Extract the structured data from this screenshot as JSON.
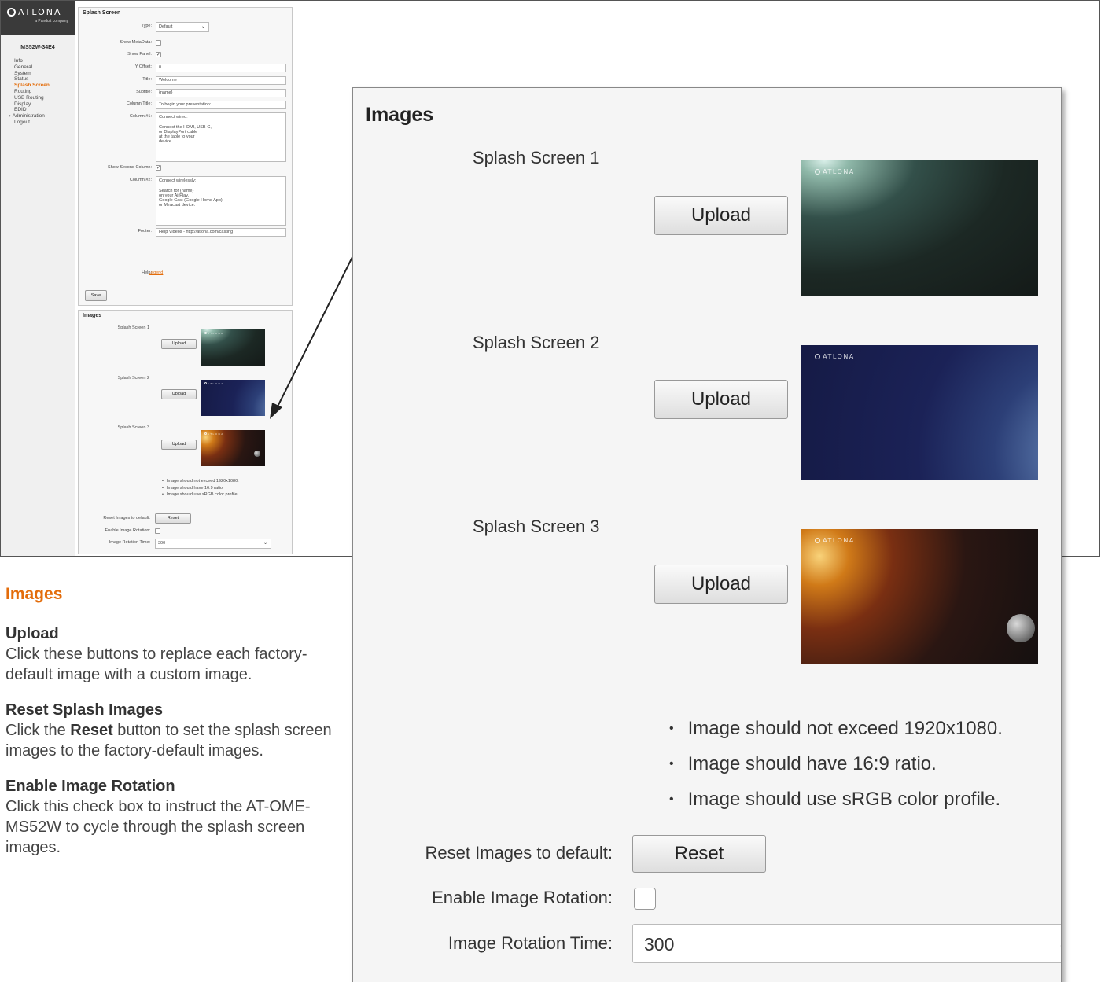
{
  "sidebar": {
    "logo": "ATLONA",
    "logo_sub": "a Panduit company",
    "device": "MS52W-34E4",
    "nav": [
      {
        "label": "Info",
        "active": false
      },
      {
        "label": "General",
        "active": false
      },
      {
        "label": "System",
        "active": false
      },
      {
        "label": "Status",
        "active": false
      },
      {
        "label": "Splash Screen",
        "active": true
      },
      {
        "label": "Routing",
        "active": false
      },
      {
        "label": "USB Routing",
        "active": false
      },
      {
        "label": "Display",
        "active": false
      },
      {
        "label": "EDID",
        "active": false
      },
      {
        "label": "▸ Administration",
        "active": false
      },
      {
        "label": "Logout",
        "active": false
      }
    ]
  },
  "splash_panel": {
    "title": "Splash Screen",
    "type_label": "Type:",
    "type_value": "Default",
    "show_metadata_label": "Show MetaData:",
    "show_metadata_checked": false,
    "show_panel_label": "Show Panel:",
    "show_panel_checked": true,
    "y_offset_label": "Y Offset:",
    "y_offset_value": "0",
    "title_label": "Title:",
    "title_value": "Welcome",
    "subtitle_label": "Subtitle:",
    "subtitle_value": "{name}",
    "column_title_label": "Column Title:",
    "column_title_value": "To begin your presentation:",
    "column1_label": "Column #1:",
    "column1_value": "Connect wired:\n\nConnect the HDMI, USB-C,\nor DisplayPort cable\nat the table to your\ndevice.",
    "show_second_column_label": "Show Second Column:",
    "show_second_column_checked": true,
    "column2_label": "Column #2:",
    "column2_value": "Connect wirelessly:\n\nSearch for {name}\non your AirPlay,\nGoogle Cast (Google Home App),\nor Miracast device.",
    "footer_label": "Footer:",
    "footer_value": "Help Videos - http://atlona.com/casting",
    "help_label": "Help:",
    "help_link": "Legend",
    "save_label": "Save"
  },
  "images": {
    "title": "Images",
    "screens": [
      {
        "label": "Splash Screen 1",
        "button": "Upload"
      },
      {
        "label": "Splash Screen 2",
        "button": "Upload"
      },
      {
        "label": "Splash Screen 3",
        "button": "Upload"
      }
    ],
    "image_logo": "ATLONA",
    "notes": [
      "Image should not exceed 1920x1080.",
      "Image should have 16:9 ratio.",
      "Image should use sRGB color profile."
    ],
    "reset_label": "Reset Images to default:",
    "reset_button": "Reset",
    "rotation_label": "Enable Image Rotation:",
    "rotation_checked": false,
    "rotation_time_label": "Image Rotation Time:",
    "rotation_time_value": "300"
  },
  "caption": {
    "title": "Images",
    "upload_heading": "Upload",
    "upload_text": "Click these buttons to replace each factory-default image with a custom image.",
    "reset_heading": "Reset Splash Images",
    "reset_text_pre": "Click the ",
    "reset_text_bold": "Reset",
    "reset_text_post": " button to set the splash screen images to the factory-default images.",
    "rotation_heading": "Enable Image Rotation",
    "rotation_text": "Click this check box to instruct the AT-OME-MS52W to cycle through the splash screen images."
  },
  "colors": {
    "accent": "#e36c0a",
    "sidebar_header": "#3a3a3a"
  }
}
